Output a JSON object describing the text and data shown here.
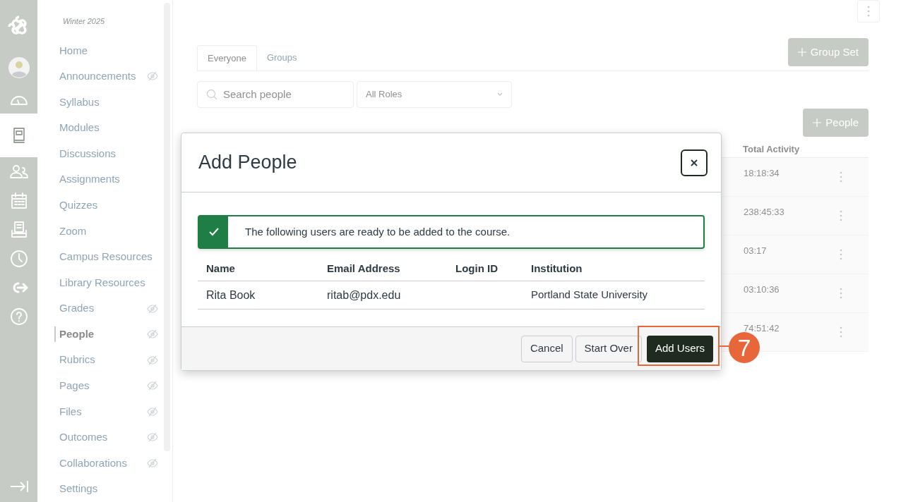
{
  "rail": {
    "items": [
      {
        "kind": "dashboard",
        "selected": false
      },
      {
        "kind": "courses",
        "selected": true
      },
      {
        "kind": "groups",
        "selected": false
      },
      {
        "kind": "calendar",
        "selected": false
      },
      {
        "kind": "inbox",
        "selected": false
      },
      {
        "kind": "history",
        "selected": false
      },
      {
        "kind": "logout",
        "selected": false
      },
      {
        "kind": "help",
        "selected": false
      }
    ]
  },
  "course_nav": {
    "term": "Winter 2025",
    "items": [
      {
        "label": "Home",
        "hidden": false,
        "selected": false
      },
      {
        "label": "Announcements",
        "hidden": true,
        "selected": false
      },
      {
        "label": "Syllabus",
        "hidden": false,
        "selected": false
      },
      {
        "label": "Modules",
        "hidden": false,
        "selected": false
      },
      {
        "label": "Discussions",
        "hidden": false,
        "selected": false
      },
      {
        "label": "Assignments",
        "hidden": false,
        "selected": false
      },
      {
        "label": "Quizzes",
        "hidden": false,
        "selected": false
      },
      {
        "label": "Zoom",
        "hidden": false,
        "selected": false
      },
      {
        "label": "Campus Resources",
        "hidden": false,
        "selected": false
      },
      {
        "label": "Library Resources",
        "hidden": false,
        "selected": false
      },
      {
        "label": "Grades",
        "hidden": true,
        "selected": false
      },
      {
        "label": "People",
        "hidden": true,
        "selected": true
      },
      {
        "label": "Rubrics",
        "hidden": true,
        "selected": false
      },
      {
        "label": "Pages",
        "hidden": true,
        "selected": false
      },
      {
        "label": "Files",
        "hidden": true,
        "selected": false
      },
      {
        "label": "Outcomes",
        "hidden": true,
        "selected": false
      },
      {
        "label": "Collaborations",
        "hidden": true,
        "selected": false
      },
      {
        "label": "Settings",
        "hidden": false,
        "selected": false
      }
    ]
  },
  "tabs": [
    {
      "label": "Everyone",
      "selected": true
    },
    {
      "label": "Groups",
      "selected": false
    }
  ],
  "group_set_button": "Group Set",
  "search": {
    "placeholder": "Search people"
  },
  "role_select": {
    "value": "All Roles"
  },
  "people_button": "People",
  "table": {
    "column": "Total Activity",
    "rows": [
      "18:18:34",
      "238:45:33",
      "03:17",
      "03:10:36",
      "74:51:42"
    ]
  },
  "dialog": {
    "title": "Add People",
    "message": "The following users are ready to be added to the course.",
    "columns": [
      "Name",
      "Email Address",
      "Login ID",
      "Institution"
    ],
    "rows": [
      [
        "Rita Book",
        "ritab@pdx.edu",
        "",
        "Portland State University"
      ]
    ],
    "buttons": [
      {
        "label": "Cancel",
        "kind": "secondary"
      },
      {
        "label": "Start Over",
        "kind": "secondary"
      },
      {
        "label": "Add Users",
        "kind": "primary"
      }
    ]
  },
  "annotation": {
    "step": "7"
  }
}
